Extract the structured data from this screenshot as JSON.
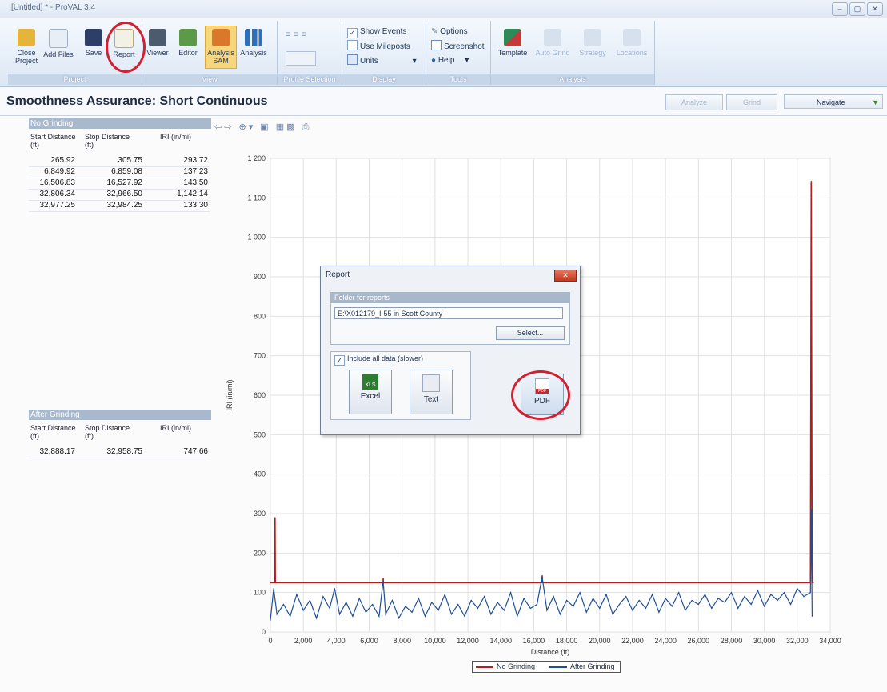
{
  "window": {
    "title": "[Untitled] * - ProVAL 3.4",
    "controls": [
      "–",
      "▢",
      "✕"
    ]
  },
  "ribbon": {
    "groups": {
      "project": "Project",
      "view": "View",
      "profile_selection": "Profile Selection",
      "display": "Display",
      "tools": "Tools",
      "analysis": "Analysis"
    },
    "buttons": {
      "close_project": "Close Project",
      "add_files": "Add Files",
      "save": "Save",
      "report": "Report",
      "viewer": "Viewer",
      "editor": "Editor",
      "analysis_sam": "Analysis SAM",
      "analysis": "Analysis",
      "template": "Template",
      "auto_grind": "Auto Grind",
      "strategy": "Strategy",
      "locations": "Locations"
    },
    "display": {
      "show_events": "Show Events",
      "use_mileposts": "Use Mileposts",
      "units": "Units"
    },
    "tools": {
      "options": "Options",
      "screenshot": "Screenshot",
      "help": "Help"
    }
  },
  "header": {
    "title": "Smoothness Assurance: Short Continuous",
    "analyze": "Analyze",
    "grind": "Grind",
    "navigate": "Navigate"
  },
  "no_grinding": {
    "title": "No Grinding",
    "columns": [
      "Start Distance (ft)",
      "Stop Distance (ft)",
      "IRI (in/mi)"
    ],
    "rows": [
      [
        "265.92",
        "305.75",
        "293.72"
      ],
      [
        "6,849.92",
        "6,859.08",
        "137.23"
      ],
      [
        "16,506.83",
        "16,527.92",
        "143.50"
      ],
      [
        "32,806.34",
        "32,966.50",
        "1,142.14"
      ],
      [
        "32,977.25",
        "32,984.25",
        "133.30"
      ]
    ]
  },
  "after_grinding": {
    "title": "After Grinding",
    "columns": [
      "Start Distance (ft)",
      "Stop Distance (ft)",
      "IRI (in/mi)"
    ],
    "rows": [
      [
        "32,888.17",
        "32,958.75",
        "747.66"
      ]
    ]
  },
  "chart_data": {
    "type": "line",
    "xlabel": "Distance (ft)",
    "ylabel": "IRI (in/mi)",
    "xlim": [
      0,
      34000
    ],
    "ylim": [
      0,
      1200
    ],
    "xticks": [
      "0",
      "2,000",
      "4,000",
      "6,000",
      "8,000",
      "10,000",
      "12,000",
      "14,000",
      "16,000",
      "18,000",
      "20,000",
      "22,000",
      "24,000",
      "26,000",
      "28,000",
      "30,000",
      "32,000",
      "34,000"
    ],
    "yticks": [
      "0",
      "100",
      "200",
      "300",
      "400",
      "500",
      "600",
      "700",
      "800",
      "900",
      "1 000",
      "1 100",
      "1 200"
    ],
    "grid": true,
    "legend_position": "bottom",
    "series": [
      {
        "name": "No Grinding",
        "color": "#b01e1e",
        "x": [
          0,
          265,
          280,
          300,
          6849,
          6855,
          6860,
          16506,
          16515,
          16528,
          32800,
          32850,
          32900,
          32966,
          32970
        ],
        "y": [
          125,
          125,
          290,
          125,
          125,
          137,
          125,
          125,
          143,
          125,
          125,
          1142,
          125,
          125,
          125
        ]
      },
      {
        "name": "After Grinding",
        "color": "#1f4f9a",
        "x": [
          0,
          200,
          400,
          800,
          1200,
          1600,
          2000,
          2400,
          2800,
          3200,
          3600,
          3900,
          4200,
          4600,
          5000,
          5400,
          5800,
          6200,
          6600,
          6850,
          7000,
          7400,
          7800,
          8200,
          8600,
          9000,
          9400,
          9800,
          10200,
          10600,
          11000,
          11400,
          11800,
          12200,
          12600,
          13000,
          13400,
          13800,
          14200,
          14600,
          15000,
          15400,
          15800,
          16200,
          16510,
          16800,
          17200,
          17600,
          18000,
          18400,
          18800,
          19200,
          19600,
          20000,
          20400,
          20800,
          21200,
          21600,
          22000,
          22400,
          22800,
          23200,
          23600,
          24000,
          24400,
          24800,
          25200,
          25600,
          26000,
          26400,
          26800,
          27200,
          27600,
          28000,
          28400,
          28800,
          29200,
          29600,
          30000,
          30400,
          30800,
          31200,
          31600,
          32000,
          32400,
          32800,
          32850,
          32900
        ],
        "y": [
          30,
          110,
          45,
          70,
          40,
          95,
          55,
          80,
          35,
          90,
          60,
          110,
          45,
          75,
          40,
          85,
          50,
          70,
          40,
          130,
          45,
          80,
          35,
          65,
          50,
          85,
          40,
          75,
          55,
          95,
          45,
          70,
          40,
          80,
          60,
          90,
          45,
          75,
          55,
          100,
          40,
          85,
          60,
          70,
          140,
          55,
          90,
          45,
          80,
          65,
          100,
          50,
          85,
          60,
          95,
          45,
          70,
          90,
          55,
          80,
          60,
          95,
          50,
          85,
          65,
          100,
          55,
          80,
          70,
          95,
          60,
          85,
          75,
          100,
          60,
          90,
          70,
          105,
          65,
          95,
          80,
          100,
          70,
          110,
          90,
          100,
          310,
          40
        ]
      }
    ]
  },
  "report_dialog": {
    "title": "Report",
    "close": "✕",
    "folder_label": "Folder for reports",
    "folder_value": "E:\\X012179_I-55 in Scott County",
    "select": "Select...",
    "include_all": "Include all data (slower)",
    "excel": "Excel",
    "text": "Text",
    "pdf": "PDF",
    "xls_badge": "XLS",
    "pdf_badge": "PDF"
  }
}
